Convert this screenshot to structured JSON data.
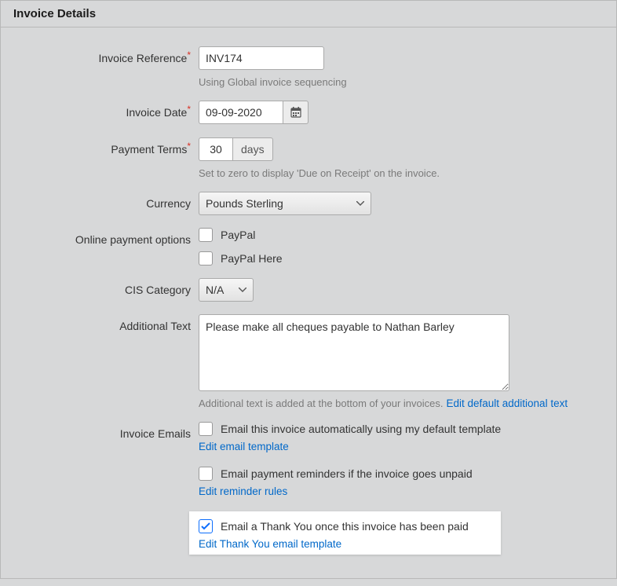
{
  "header": {
    "title": "Invoice Details"
  },
  "form": {
    "invoice_reference": {
      "label": "Invoice Reference",
      "value": "INV174",
      "help": "Using Global invoice sequencing"
    },
    "invoice_date": {
      "label": "Invoice Date",
      "value": "09-09-2020"
    },
    "payment_terms": {
      "label": "Payment Terms",
      "value": "30",
      "unit": "days",
      "help": "Set to zero to display 'Due on Receipt' on the invoice."
    },
    "currency": {
      "label": "Currency",
      "selected": "Pounds Sterling"
    },
    "online_payment": {
      "label": "Online payment options",
      "option1": "PayPal",
      "option2": "PayPal Here"
    },
    "cis_category": {
      "label": "CIS Category",
      "selected": "N/A"
    },
    "additional_text": {
      "label": "Additional Text",
      "value": "Please make all cheques payable to Nathan Barley",
      "help": "Additional text is added at the bottom of your invoices.",
      "link": "Edit default additional text"
    },
    "invoice_emails": {
      "label": "Invoice Emails",
      "email_auto": {
        "label": "Email this invoice automatically using my default template",
        "link": "Edit email template"
      },
      "email_reminder": {
        "label": "Email payment reminders if the invoice goes unpaid",
        "link": "Edit reminder rules"
      },
      "email_thankyou": {
        "label": "Email a Thank You once this invoice has been paid",
        "link": "Edit Thank You email template"
      }
    }
  }
}
